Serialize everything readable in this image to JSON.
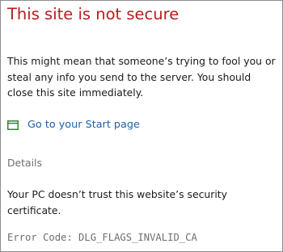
{
  "page": {
    "title": "This site is not secure",
    "message": "This might mean that someone’s trying to fool you or steal any info you send to the server. You should close this site immediately."
  },
  "start_link": {
    "icon": "browser-window-icon",
    "label": "Go to your Start page"
  },
  "details": {
    "toggle_label": "Details",
    "text": "Your PC doesn’t trust this website’s security certificate.",
    "error_code": "Error Code:  DLG_FLAGS_INVALID_CA"
  },
  "colors": {
    "title": "#b91c1c",
    "link": "#1f5fa6",
    "link_icon": "#2e8b2e",
    "muted_text": "#6e6e6e",
    "border": "#8c8c8c"
  }
}
